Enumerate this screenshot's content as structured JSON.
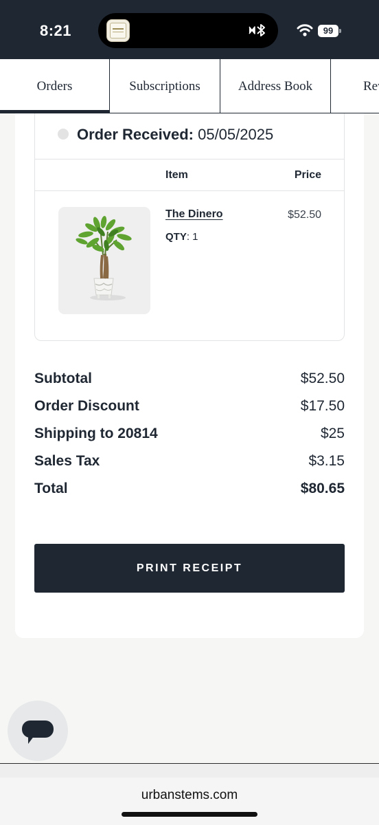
{
  "status_bar": {
    "time": "8:21",
    "battery": "99",
    "icons": [
      "app-icon",
      "bluetooth-icon",
      "wifi-icon",
      "battery-icon"
    ]
  },
  "tabs": [
    {
      "label": "Orders",
      "active": true
    },
    {
      "label": "Subscriptions",
      "active": false
    },
    {
      "label": "Address Book",
      "active": false
    },
    {
      "label": "Rev",
      "active": false
    }
  ],
  "order": {
    "status_label": "Order Received:",
    "status_date": "05/05/2025",
    "columns": {
      "item": "Item",
      "price": "Price"
    },
    "items": [
      {
        "name": "The Dinero",
        "qty_label": "QTY",
        "qty": ": 1",
        "price": "$52.50"
      }
    ]
  },
  "summary": [
    {
      "label": "Subtotal",
      "value": "$52.50"
    },
    {
      "label": "Order Discount",
      "value": "$17.50"
    },
    {
      "label": "Shipping to 20814",
      "value": "$25"
    },
    {
      "label": "Sales Tax",
      "value": "$3.15"
    },
    {
      "label": "Total",
      "value": "$80.65"
    }
  ],
  "actions": {
    "print_label": "PRINT RECEIPT"
  },
  "browser": {
    "url": "urbanstems.com"
  },
  "colors": {
    "primary": "#1f2733",
    "background": "#f6f6f5",
    "border": "#e2e3e4"
  }
}
